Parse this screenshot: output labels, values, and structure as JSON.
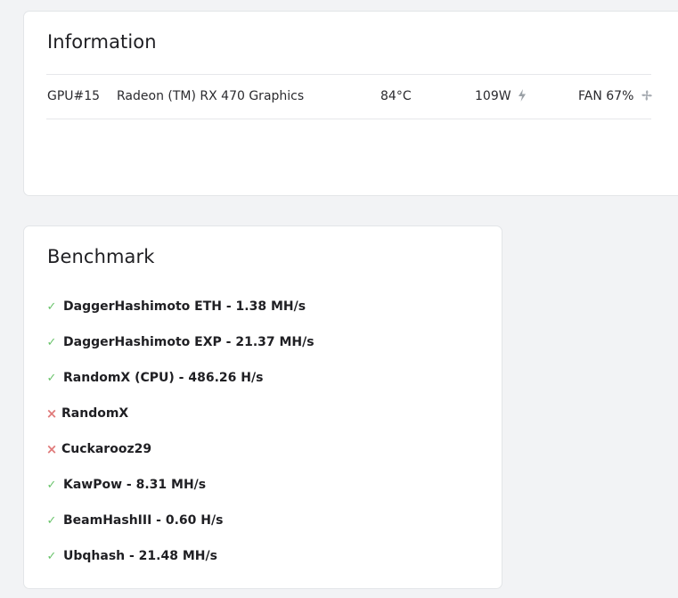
{
  "information": {
    "title": "Information",
    "gpu": {
      "id": "GPU#15",
      "name": "Radeon (TM) RX 470 Graphics",
      "temperature": "84°C",
      "power": "109W",
      "fan": "FAN 67%"
    }
  },
  "benchmark": {
    "title": "Benchmark",
    "items": [
      {
        "label": "DaggerHashimoto ETH - 1.38 MH/s",
        "status": "ok"
      },
      {
        "label": "DaggerHashimoto EXP - 21.37 MH/s",
        "status": "ok"
      },
      {
        "label": "RandomX (CPU) - 486.26 H/s",
        "status": "ok"
      },
      {
        "label": "RandomX",
        "status": "fail"
      },
      {
        "label": "Cuckarooz29",
        "status": "fail"
      },
      {
        "label": "KawPow - 8.31 MH/s",
        "status": "ok"
      },
      {
        "label": "BeamHashIII - 0.60 H/s",
        "status": "ok"
      },
      {
        "label": "Ubqhash - 21.48 MH/s",
        "status": "ok"
      }
    ]
  },
  "icons": {
    "power": "bolt-icon",
    "fan": "fan-icon",
    "ok": "check-icon",
    "fail": "cross-icon"
  },
  "colors": {
    "ok": "#69c36b",
    "fail": "#e07a7a",
    "background": "#f2f3f5",
    "card": "#ffffff"
  }
}
